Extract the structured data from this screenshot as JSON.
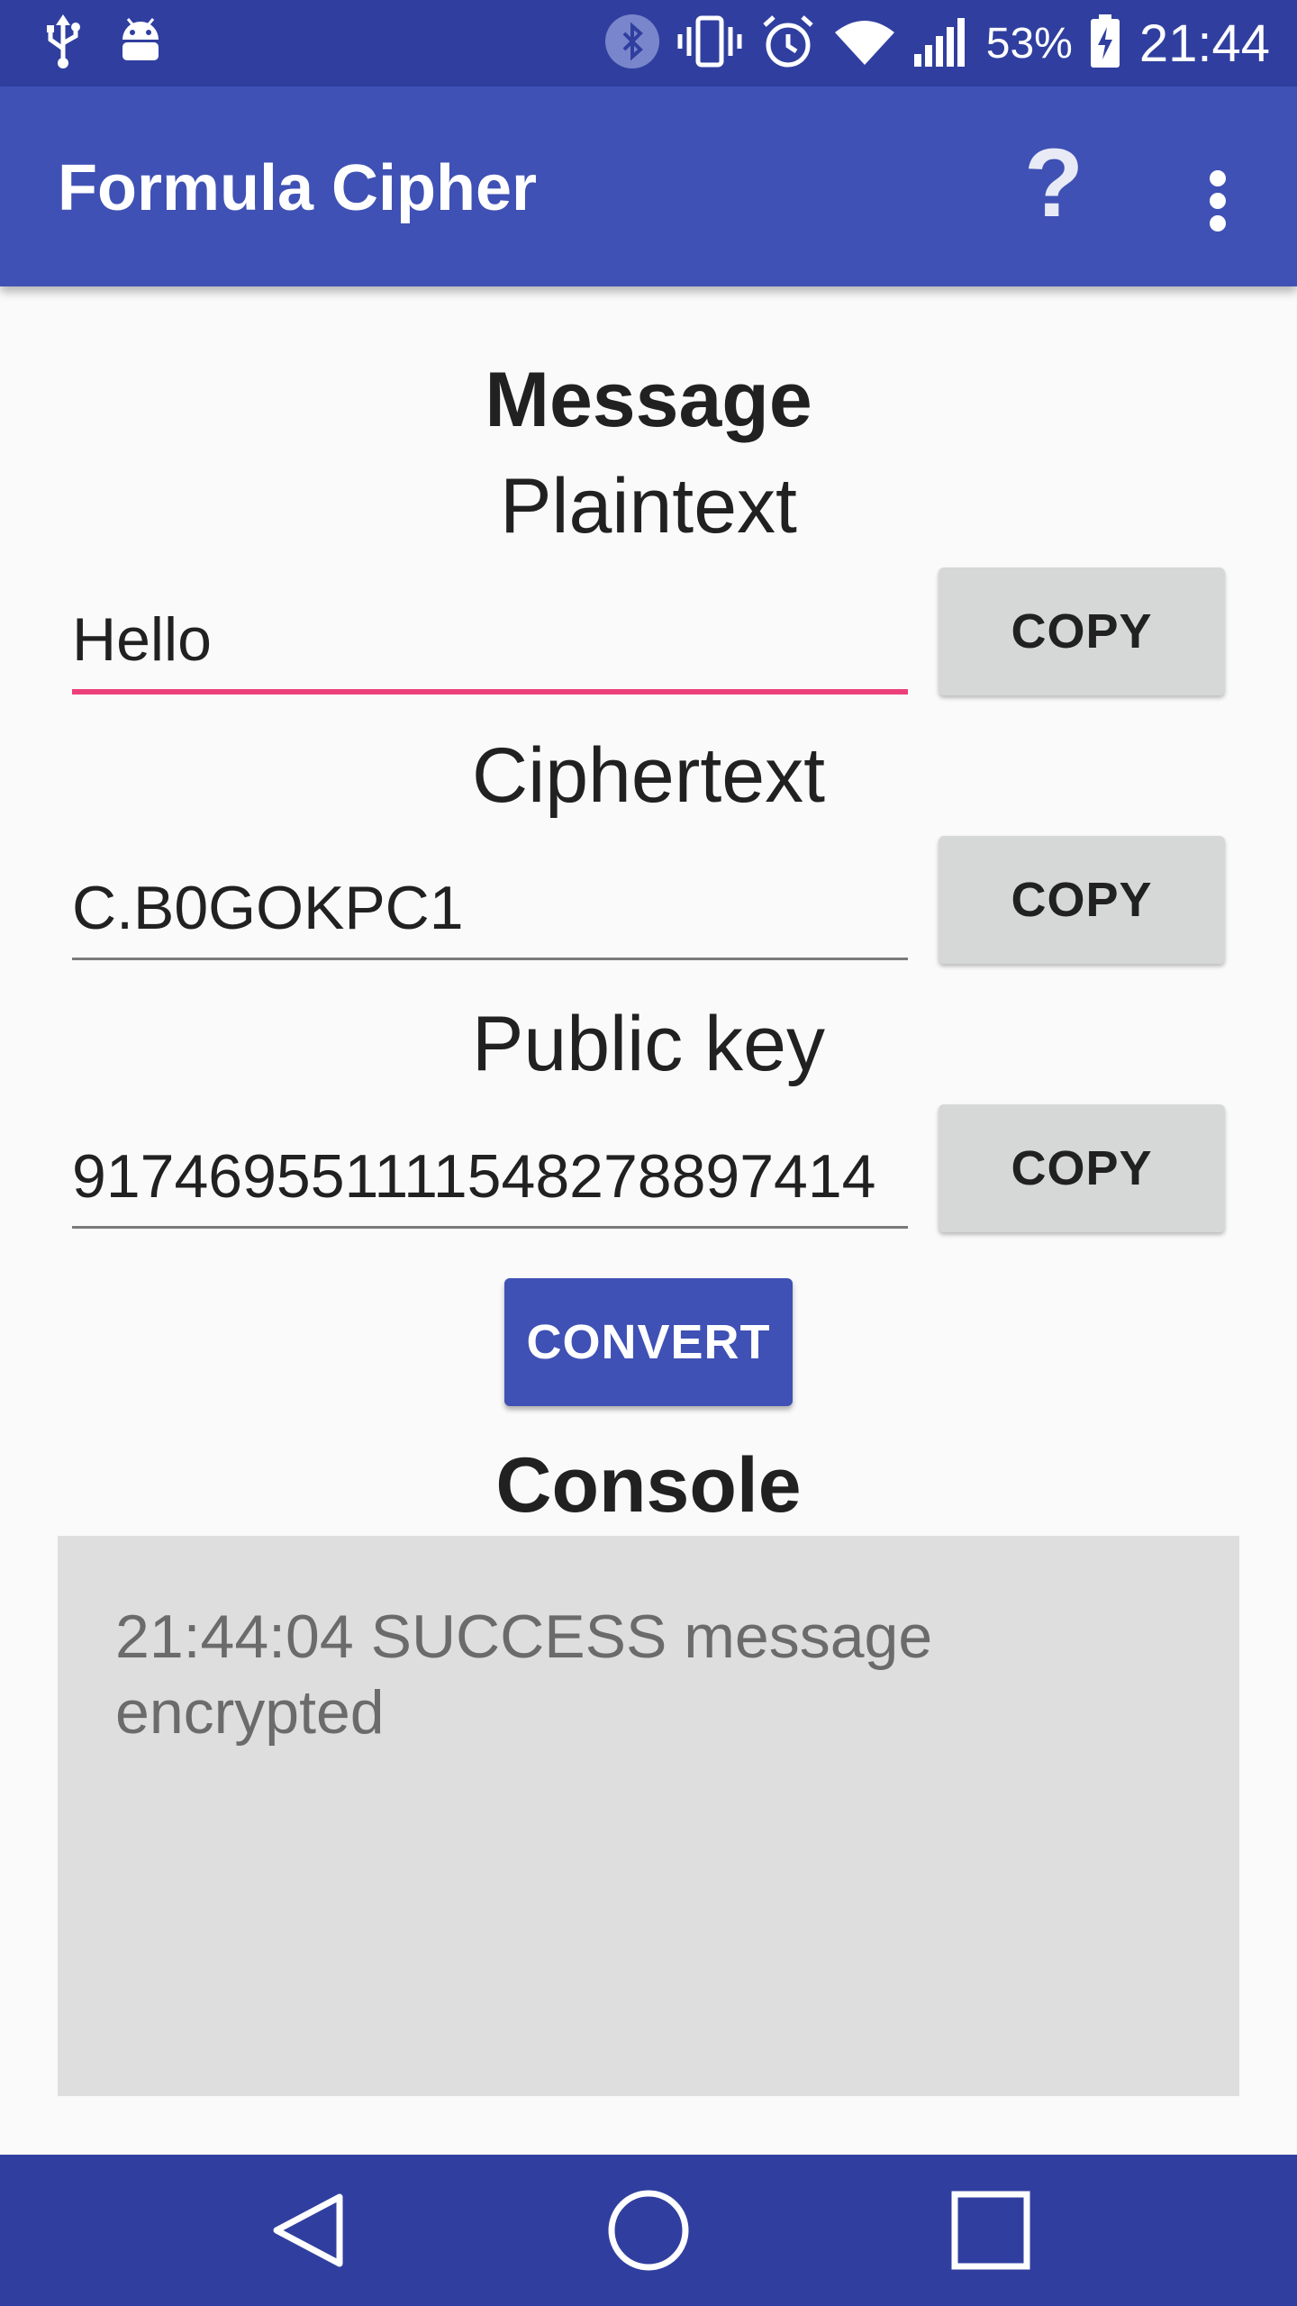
{
  "status_bar": {
    "battery_percent": "53%",
    "time": "21:44",
    "icons": [
      "usb-icon",
      "android-debug-icon",
      "bluetooth-icon",
      "vibrate-icon",
      "alarm-icon",
      "wifi-icon",
      "signal-icon",
      "battery-charging-icon"
    ]
  },
  "app_bar": {
    "title": "Formula Cipher",
    "help_label": "?",
    "icons": [
      "help-icon",
      "more-vert-icon"
    ]
  },
  "main": {
    "message_heading": "Message",
    "plaintext": {
      "label": "Plaintext",
      "value": "Hello",
      "copy_label": "COPY"
    },
    "ciphertext": {
      "label": "Ciphertext",
      "value": "C.B0GOKPC1",
      "copy_label": "COPY"
    },
    "public_key": {
      "label": "Public key",
      "value": "917469551111548278897414",
      "copy_label": "COPY"
    },
    "convert_label": "CONVERT",
    "console_heading": "Console",
    "console_text": "21:44:04 SUCCESS message encrypted"
  },
  "nav_bar": {
    "icons": [
      "back-icon",
      "home-icon",
      "recents-icon"
    ]
  },
  "colors": {
    "primary": "#3f51b5",
    "primary_dark": "#303f9f",
    "accent": "#ec407a",
    "button_grey": "#d6d7d7",
    "console_bg": "#dedede"
  }
}
